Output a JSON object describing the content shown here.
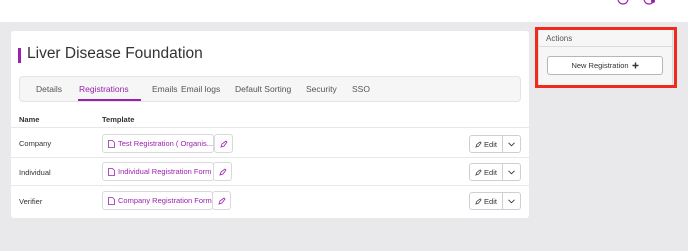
{
  "header": {
    "title": "Liver Disease Foundation"
  },
  "tabs": [
    {
      "label": "Details",
      "active": false
    },
    {
      "label": "Registrations",
      "active": true
    },
    {
      "label": "Emails",
      "active": false
    },
    {
      "label": "Email logs",
      "active": false
    },
    {
      "label": "Default Sorting",
      "active": false
    },
    {
      "label": "Security",
      "active": false
    },
    {
      "label": "SSO",
      "active": false
    }
  ],
  "table": {
    "columns": [
      "Name",
      "Template"
    ],
    "rows": [
      {
        "name": "Company",
        "template": "Test Registration ( Organis...",
        "edit_label": "Edit"
      },
      {
        "name": "Individual",
        "template": "Individual Registration Form",
        "edit_label": "Edit"
      },
      {
        "name": "Verifier",
        "template": "Company Registration Form",
        "edit_label": "Edit"
      }
    ]
  },
  "actions": {
    "heading": "Actions",
    "new_registration_label": "New Registration"
  },
  "colors": {
    "accent": "#9b21b0",
    "highlight": "#ee2b1c",
    "background": "#e9e9ec"
  },
  "icons": [
    "user-icon",
    "logout-icon",
    "document-icon",
    "pencil-icon",
    "chevron-down-icon",
    "plus-icon"
  ]
}
